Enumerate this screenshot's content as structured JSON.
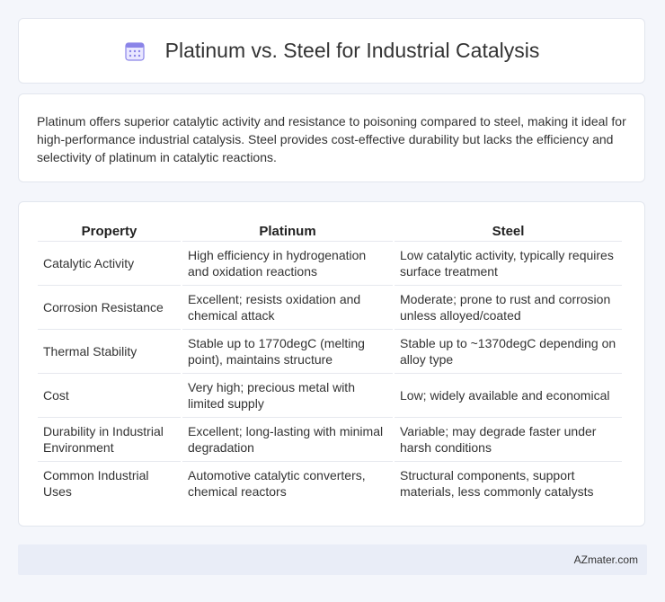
{
  "header": {
    "title": "Platinum vs. Steel for Industrial Catalysis",
    "icon": "calendar-icon",
    "icon_color": "#8a84e8"
  },
  "summary": {
    "text": "Platinum offers superior catalytic activity and resistance to poisoning compared to steel, making it ideal for high-performance industrial catalysis. Steel provides cost-effective durability but lacks the efficiency and selectivity of platinum in catalytic reactions."
  },
  "table": {
    "headers": [
      "Property",
      "Platinum",
      "Steel"
    ],
    "rows": [
      [
        "Catalytic Activity",
        "High efficiency in hydrogenation and oxidation reactions",
        "Low catalytic activity, typically requires surface treatment"
      ],
      [
        "Corrosion Resistance",
        "Excellent; resists oxidation and chemical attack",
        "Moderate; prone to rust and corrosion unless alloyed/coated"
      ],
      [
        "Thermal Stability",
        "Stable up to 1770degC (melting point), maintains structure",
        "Stable up to ~1370degC depending on alloy type"
      ],
      [
        "Cost",
        "Very high; precious metal with limited supply",
        "Low; widely available and economical"
      ],
      [
        "Durability in Industrial Environment",
        "Excellent; long-lasting with minimal degradation",
        "Variable; may degrade faster under harsh conditions"
      ],
      [
        "Common Industrial Uses",
        "Automotive catalytic converters, chemical reactors",
        "Structural components, support materials, less commonly catalysts"
      ]
    ]
  },
  "footer": {
    "brand": "AZmater.com"
  }
}
